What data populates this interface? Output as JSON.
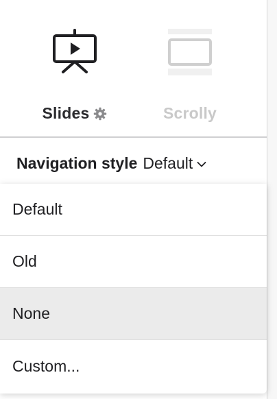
{
  "modes": {
    "slides": {
      "label": "Slides",
      "icon": "presentation-screen-icon",
      "settings_icon": "gear-icon",
      "selected": true
    },
    "scrolly": {
      "label": "Scrolly",
      "icon": "scroll-page-icon",
      "selected": false
    }
  },
  "navigation_style": {
    "label": "Navigation style",
    "value": "Default",
    "icon": "chevron-down-icon"
  },
  "dropdown": {
    "options": [
      {
        "label": "Default",
        "highlighted": false
      },
      {
        "label": "Old",
        "highlighted": false
      },
      {
        "label": "None",
        "highlighted": true
      },
      {
        "label": "Custom...",
        "highlighted": false
      }
    ]
  },
  "colors": {
    "text_primary": "#1f1f22",
    "text_disabled": "#c9c9c9",
    "highlight_bg": "#ebebeb",
    "divider": "#cfcfd1"
  }
}
